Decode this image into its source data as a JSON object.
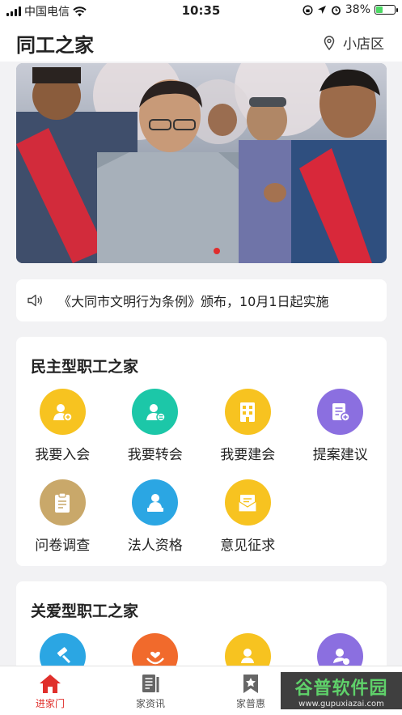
{
  "status_bar": {
    "carrier": "中国电信",
    "time": "10:35",
    "battery": "38%",
    "battery_level": 0.38
  },
  "header": {
    "title": "同工之家",
    "location": "小店区"
  },
  "notice": {
    "text": "《大同市文明行为条例》颁布，10月1日起实施"
  },
  "section1": {
    "title": "民主型职工之家",
    "items": [
      {
        "label": "我要入会",
        "icon": "join-icon",
        "color": "#f7c320"
      },
      {
        "label": "我要转会",
        "icon": "transfer-icon",
        "color": "#1cc7a8"
      },
      {
        "label": "我要建会",
        "icon": "building-icon",
        "color": "#f7c320"
      },
      {
        "label": "提案建议",
        "icon": "proposal-icon",
        "color": "#8b6fe0"
      },
      {
        "label": "问卷调查",
        "icon": "survey-icon",
        "color": "#c9a86a"
      },
      {
        "label": "法人资格",
        "icon": "legal-person-icon",
        "color": "#2ba6e3"
      },
      {
        "label": "意见征求",
        "icon": "feedback-envelope-icon",
        "color": "#f7c320"
      }
    ]
  },
  "section2": {
    "title": "关爱型职工之家"
  },
  "tabs": [
    {
      "label": "进家门",
      "icon": "home-icon",
      "active": true
    },
    {
      "label": "家资讯",
      "icon": "news-icon",
      "active": false
    },
    {
      "label": "家普惠",
      "icon": "benefit-star-icon",
      "active": false
    }
  ],
  "watermark": {
    "main": "谷普软件园",
    "url": "www.gupuxiazai.com"
  }
}
